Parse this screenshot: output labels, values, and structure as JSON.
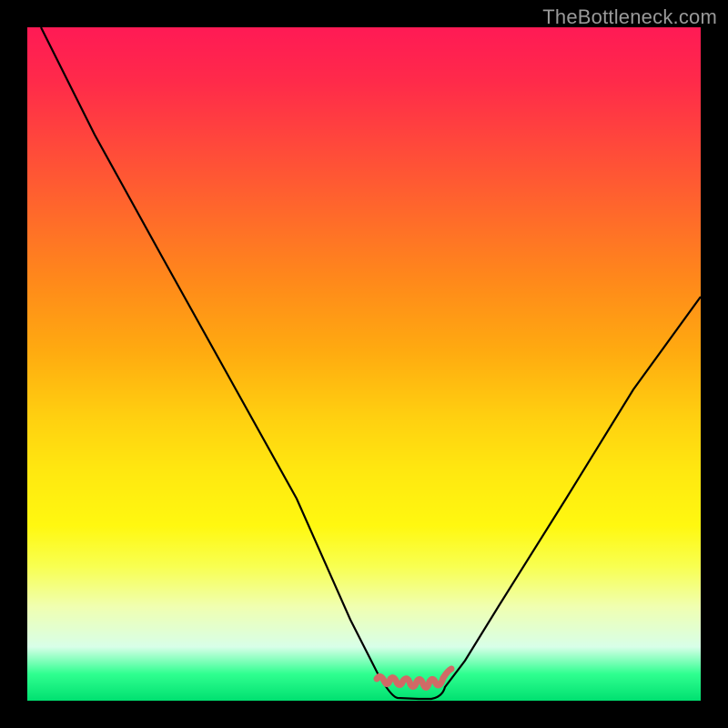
{
  "watermark": "TheBottleneck.com",
  "chart_data": {
    "type": "line",
    "title": "",
    "xlabel": "",
    "ylabel": "",
    "xlim": [
      0,
      100
    ],
    "ylim": [
      0,
      100
    ],
    "grid": false,
    "legend": false,
    "background": "rainbow-gradient (red→green, top→bottom)",
    "series": [
      {
        "name": "bottleneck-curve",
        "color": "#000000",
        "x": [
          2,
          10,
          20,
          30,
          40,
          48,
          52,
          55,
          58,
          60,
          62,
          65,
          70,
          80,
          90,
          100
        ],
        "y": [
          100,
          84,
          66,
          48,
          30,
          12,
          4,
          0,
          0,
          0,
          2,
          6,
          14,
          30,
          46,
          60
        ]
      },
      {
        "name": "green-zone-marker",
        "color": "#d06a66",
        "x": [
          52,
          53,
          54,
          55,
          56,
          57,
          58,
          59,
          60,
          61,
          62,
          63
        ],
        "y": [
          3,
          1,
          0.6,
          0.4,
          0.3,
          0.3,
          0.3,
          0.4,
          0.6,
          1,
          2,
          3
        ]
      }
    ],
    "notes": "Black V-curve descends from top-left to a flat minimum around x=55–62 then rises; pale-red wobbly marker sits on the flat minimum."
  }
}
